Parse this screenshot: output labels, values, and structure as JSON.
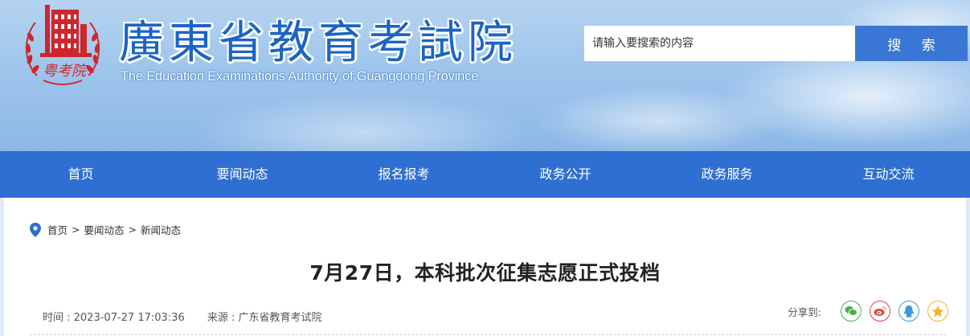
{
  "header": {
    "emblem_text": "粤考院",
    "title_cn": "廣東省教育考試院",
    "title_en": "The Education Examinations Authority of Guangdong Province"
  },
  "search": {
    "placeholder": "请输入要搜索的内容",
    "button_label": "搜 索"
  },
  "nav": {
    "items": [
      {
        "label": "首页"
      },
      {
        "label": "要闻动态"
      },
      {
        "label": "报名报考"
      },
      {
        "label": "政务公开"
      },
      {
        "label": "政务服务"
      },
      {
        "label": "互动交流"
      }
    ]
  },
  "breadcrumb": {
    "items": [
      "首页",
      "要闻动态",
      "新闻动态"
    ],
    "separator": ">"
  },
  "article": {
    "title": "7月27日，本科批次征集志愿正式投档",
    "time": "时间 : 2023-07-27 17:03:36",
    "source": "来源 : 广东省教育考试院"
  },
  "share": {
    "label": "分享到:",
    "targets": [
      {
        "icon": "wechat-icon",
        "color": "#4cae4c"
      },
      {
        "icon": "weibo-icon",
        "color": "#e0453a"
      },
      {
        "icon": "qq-icon",
        "color": "#3a9bd9"
      },
      {
        "icon": "qzone-icon",
        "color": "#f0b22c"
      }
    ]
  },
  "colors": {
    "brand_blue": "#2f6fd1",
    "emblem_red": "#d0262b",
    "title_blue": "#1b64c4"
  }
}
